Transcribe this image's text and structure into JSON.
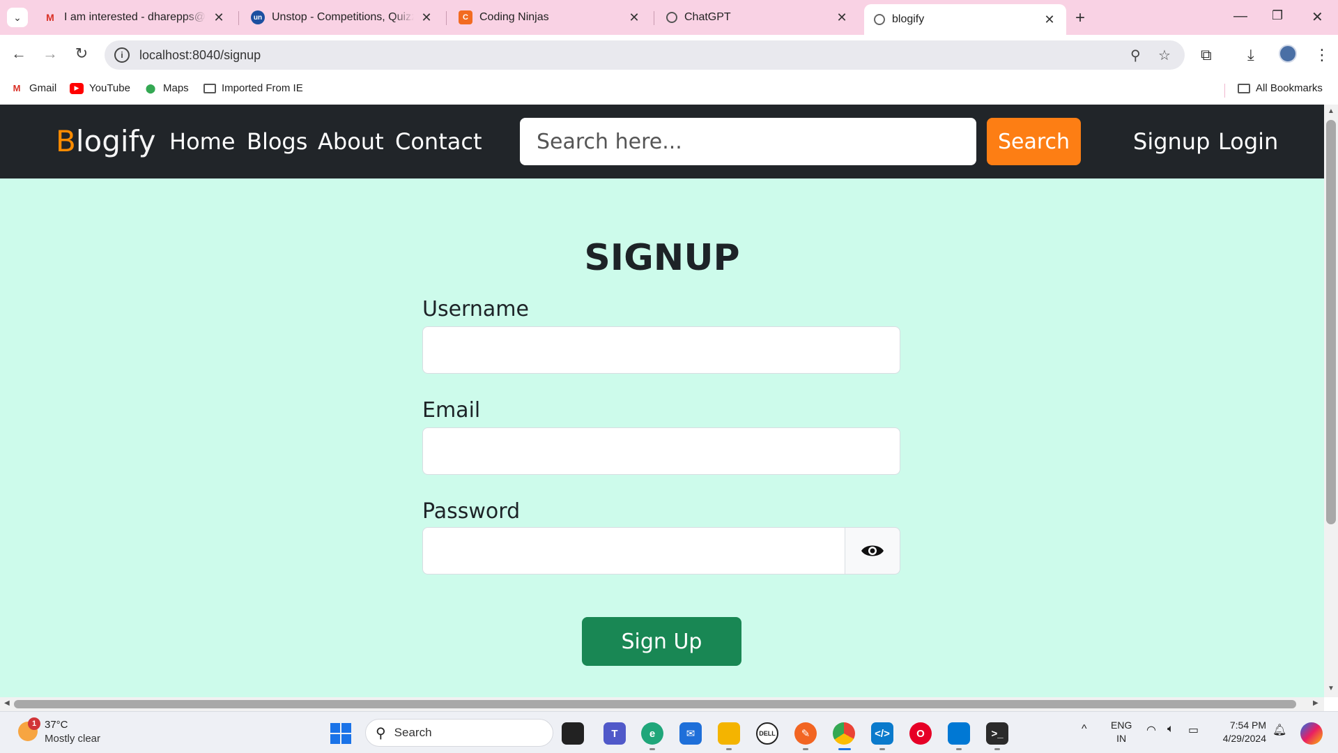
{
  "browser": {
    "tabs": [
      {
        "title": "I am interested - dharepps@gm",
        "favicon": "gmail-icon"
      },
      {
        "title": "Unstop - Competitions, Quizze",
        "favicon": "unstop-icon"
      },
      {
        "title": "Coding Ninjas",
        "favicon": "coding-ninjas-icon"
      },
      {
        "title": "ChatGPT",
        "favicon": "chatgpt-icon"
      },
      {
        "title": "blogify",
        "favicon": "globe-icon"
      }
    ],
    "url": "localhost:8040/signup",
    "bookmarks": [
      {
        "label": "Gmail"
      },
      {
        "label": "YouTube"
      },
      {
        "label": "Maps"
      },
      {
        "label": "Imported From IE"
      }
    ],
    "all_bookmarks": "All Bookmarks"
  },
  "site": {
    "brand_first": "B",
    "brand_rest": "logify",
    "nav": {
      "home": "Home",
      "blogs": "Blogs",
      "about": "About",
      "contact": "Contact",
      "signup": "Signup",
      "login": "Login"
    },
    "search_placeholder": "Search here...",
    "search_button": "Search",
    "accent_color": "#fd7e14",
    "navbar_color": "#212529",
    "page_bg": "#cdfbeb"
  },
  "form": {
    "title": "SIGNUP",
    "username_label": "Username",
    "email_label": "Email",
    "password_label": "Password",
    "submit_label": "Sign Up",
    "submit_color": "#198754"
  },
  "taskbar": {
    "weather_badge": "1",
    "weather_temp": "37°C",
    "weather_desc": "Mostly clear",
    "search_label": "Search",
    "lang_line1": "ENG",
    "lang_line2": "IN",
    "time": "7:54 PM",
    "date": "4/29/2024"
  }
}
